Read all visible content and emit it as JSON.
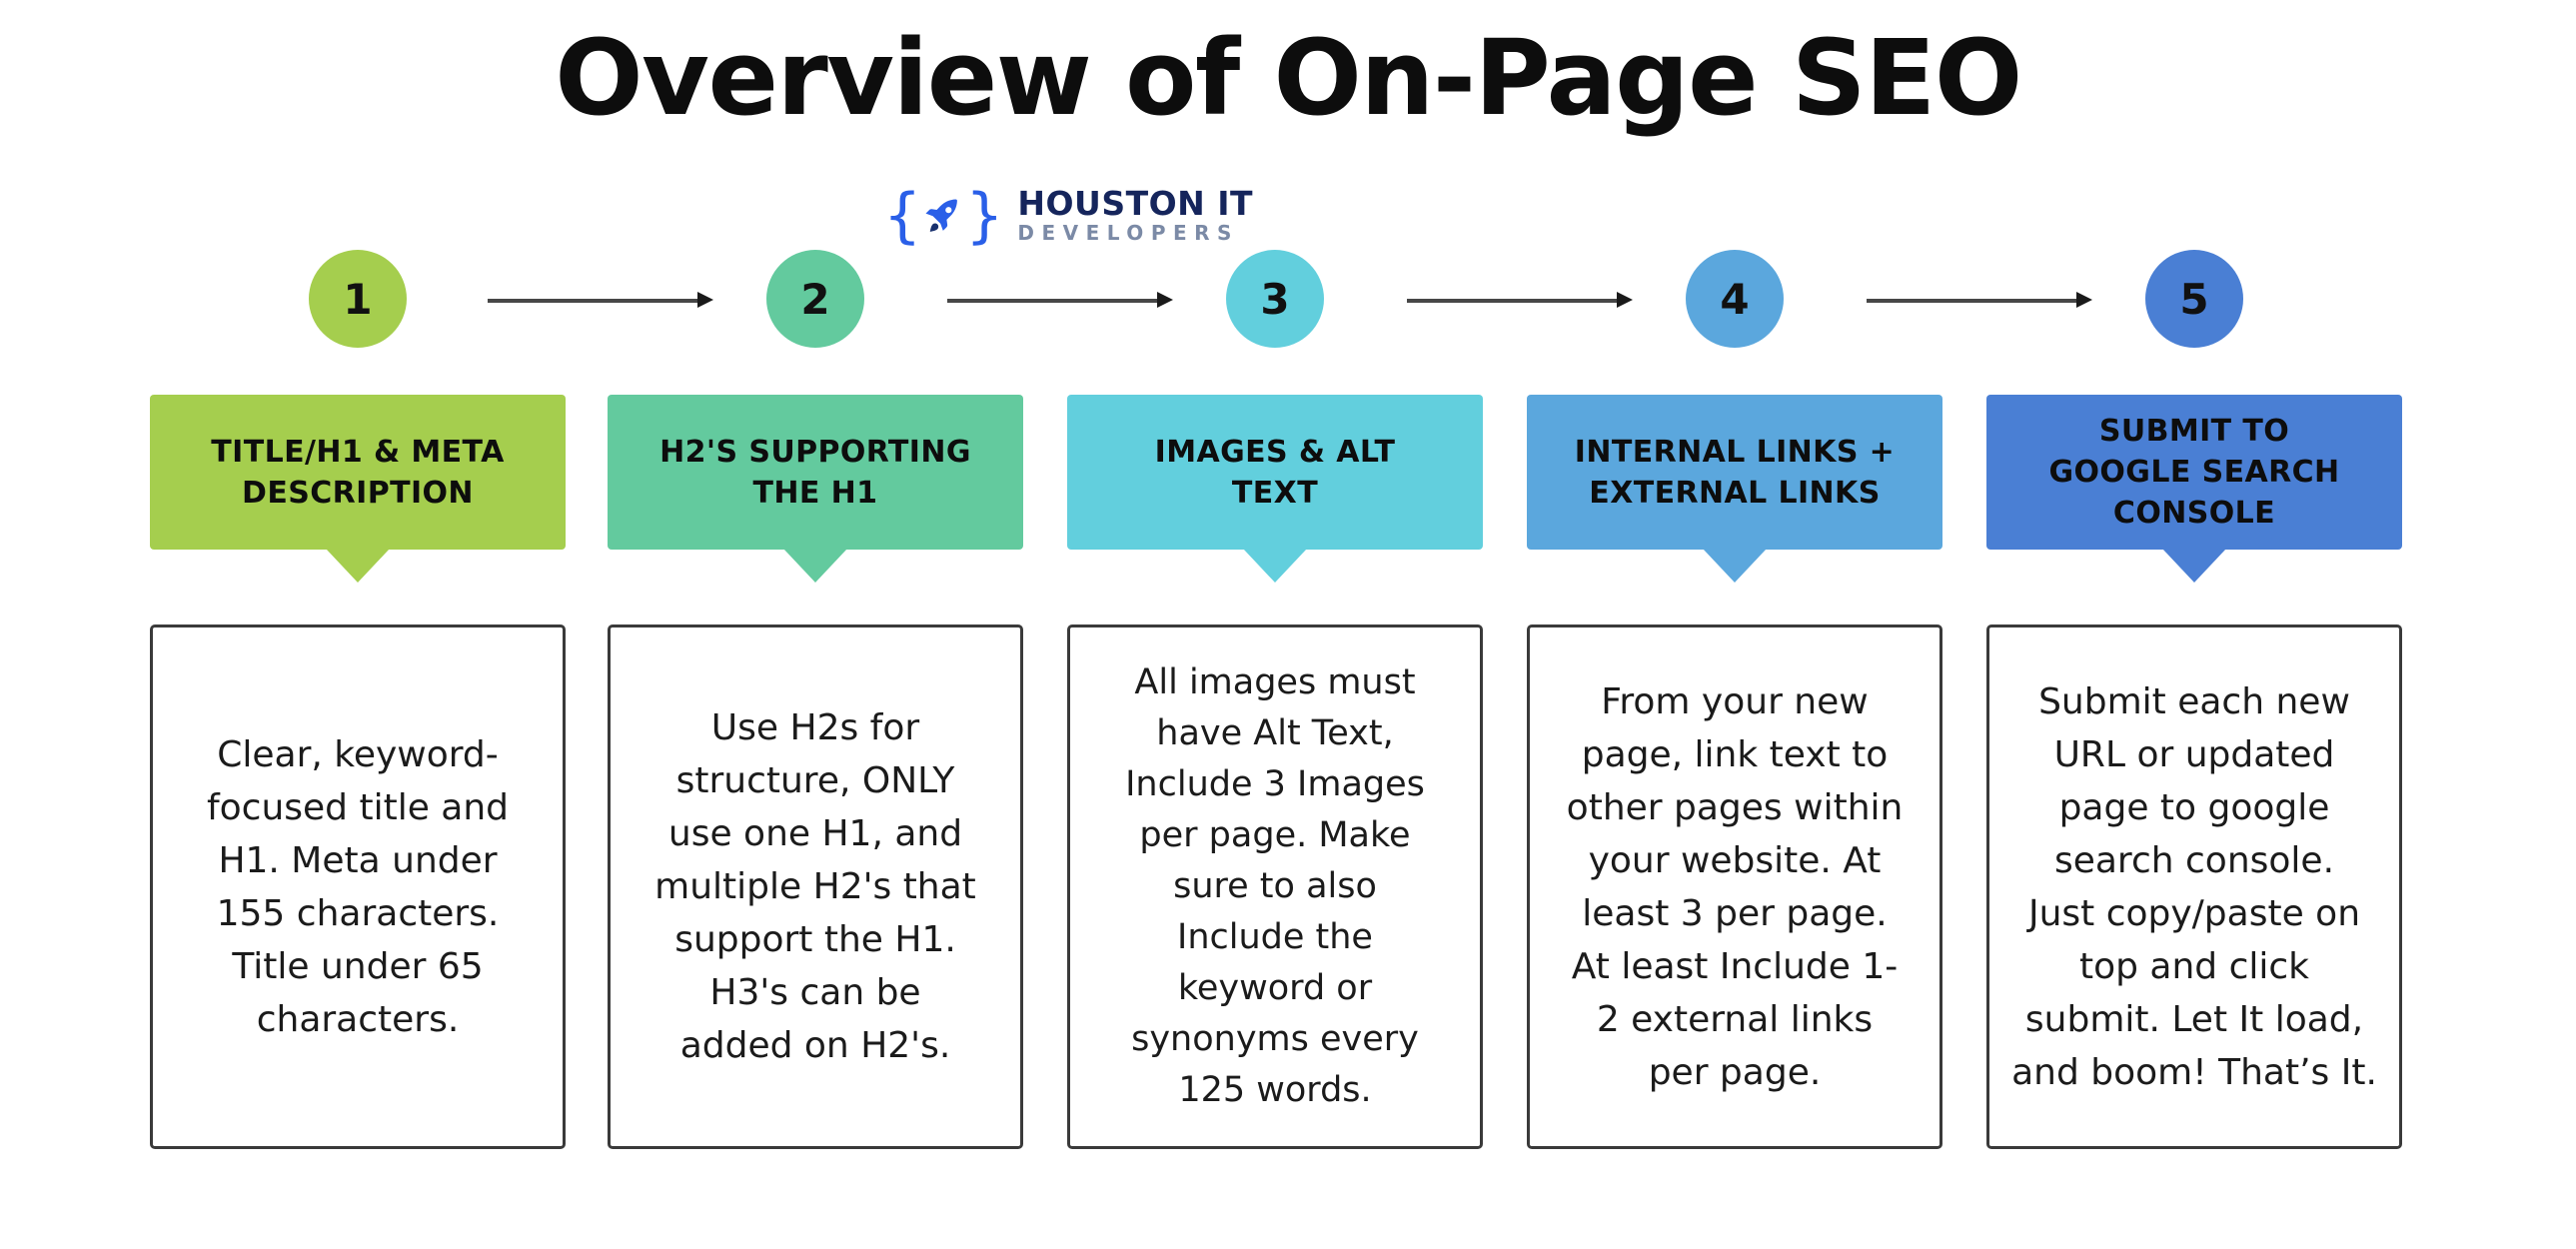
{
  "header": {
    "title": "Overview of On-Page SEO"
  },
  "logo": {
    "brace_open": "{",
    "brace_close": "}",
    "icon": "rocket-icon",
    "line1": "HOUSTON IT",
    "line2": "DEVELOPERS",
    "brace_color": "#2a5fe8",
    "rocket_color": "#2a5fe8",
    "line1_color": "#15255c",
    "line2_color": "#7b8aa6"
  },
  "arrows": [
    {
      "label": "arrow-1-to-2"
    },
    {
      "label": "arrow-2-to-3"
    },
    {
      "label": "arrow-3-to-4"
    },
    {
      "label": "arrow-4-to-5"
    }
  ],
  "steps": [
    {
      "number": "1",
      "color": "#a5ce4e",
      "banner": "TITLE/H1 & META\nDESCRIPTION",
      "body": "Clear, keyword-\nfocused title and\nH1. Meta under\n155 characters.\nTitle under 65\ncharacters."
    },
    {
      "number": "2",
      "color": "#63ca9e",
      "banner": "H2'S SUPPORTING\nTHE H1",
      "body": "Use H2s for\nstructure, ONLY\nuse one H1, and\nmultiple H2's that\nsupport the H1.\nH3's can be\nadded on H2's."
    },
    {
      "number": "3",
      "color": "#62cfdd",
      "banner": "IMAGES & ALT\nTEXT",
      "body": "All images must\nhave Alt Text,\nInclude 3 Images\nper page. Make\nsure to also\nInclude the\nkeyword or\nsynonyms every\n125 words."
    },
    {
      "number": "4",
      "color": "#5ba7dd",
      "banner": "INTERNAL LINKS +\nEXTERNAL LINKS",
      "body": "From your new\npage, link text to\nother pages within\nyour website. At\nleast 3 per page.\nAt least Include 1-\n2 external links\nper page."
    },
    {
      "number": "5",
      "color": "#4a7fd4",
      "banner": "SUBMIT TO\nGOOGLE SEARCH\nCONSOLE",
      "body": "Submit each new\nURL or updated\npage to google\nsearch console.\nJust copy/paste on\ntop and click\nsubmit. Let It load,\nand boom! That’s It."
    }
  ]
}
